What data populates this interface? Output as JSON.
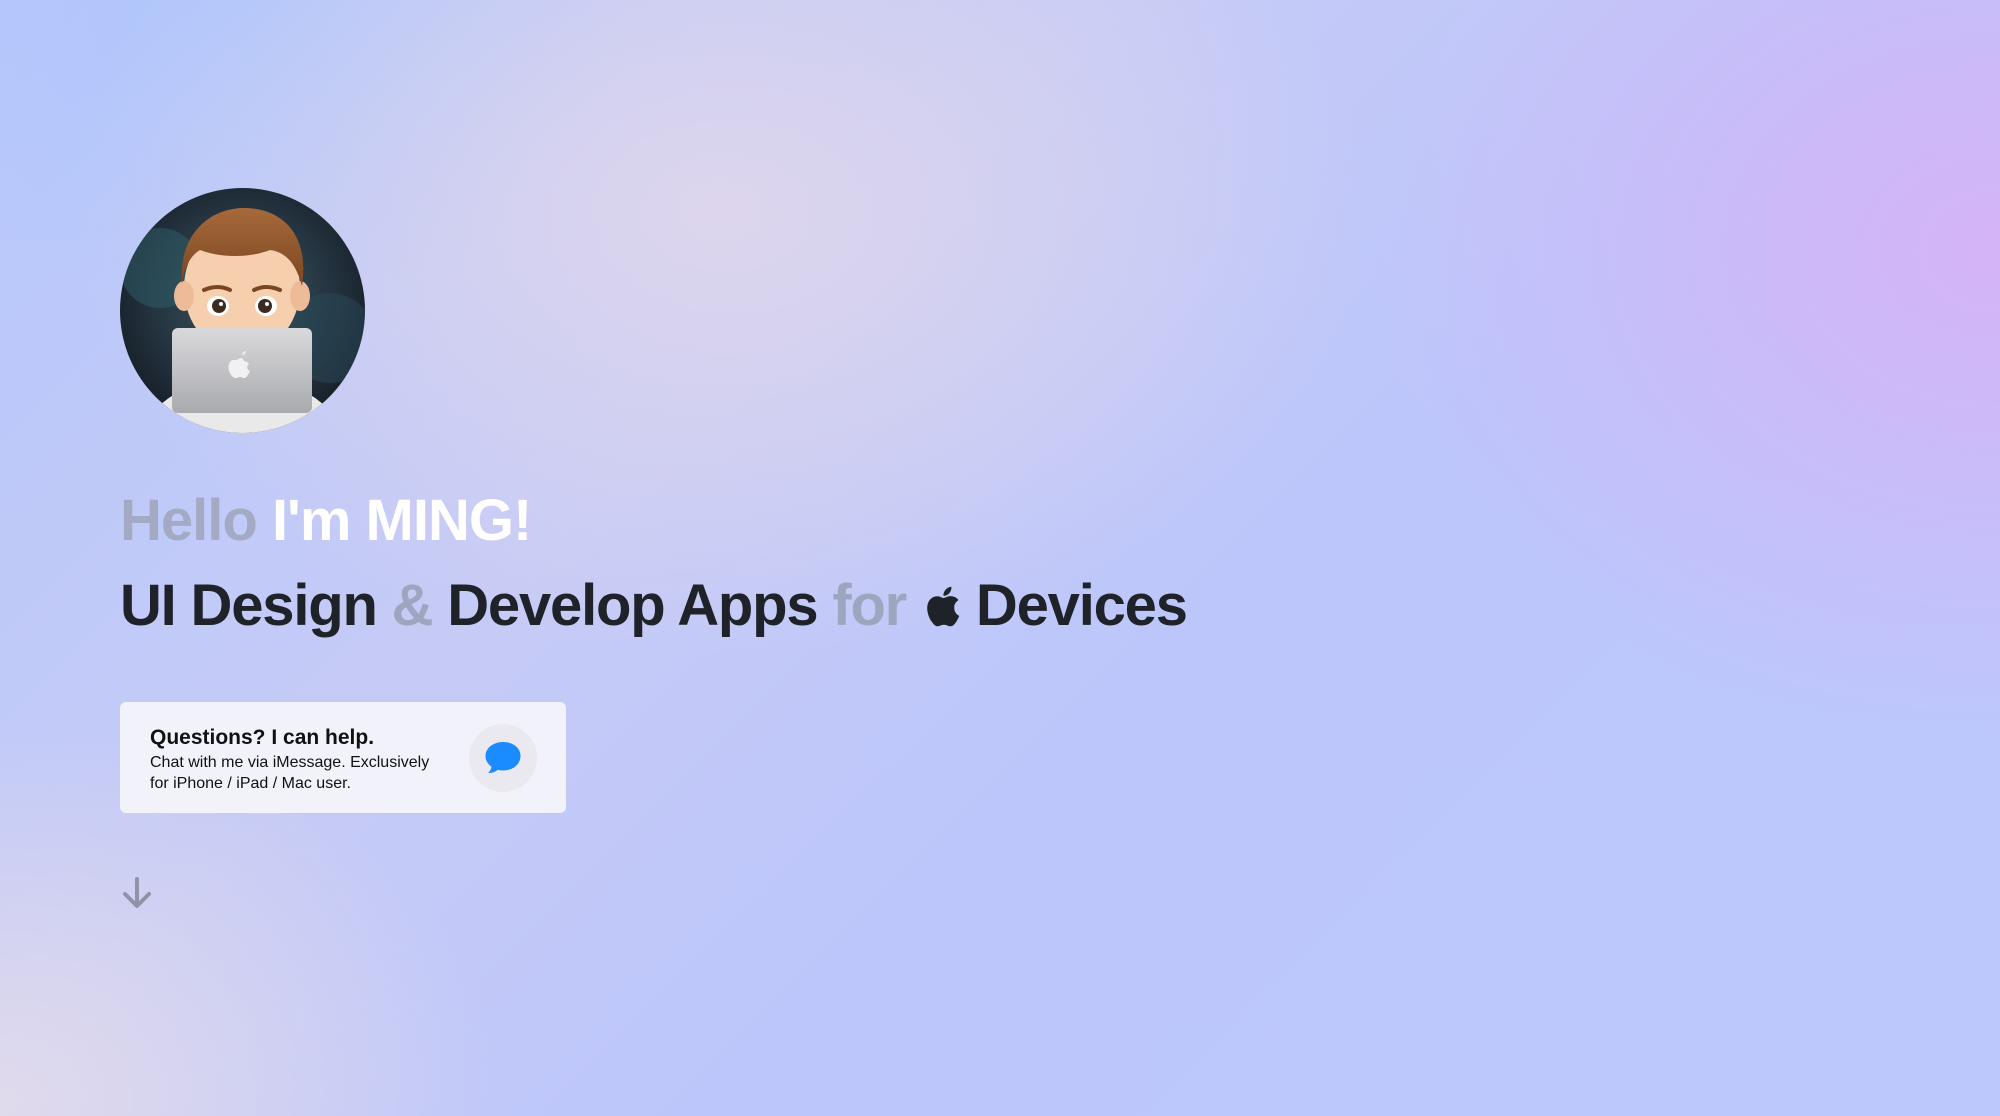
{
  "hero": {
    "greeting": {
      "hello": "Hello",
      "im": "I'm",
      "name": "MING!"
    },
    "tagline": {
      "ui_design": "UI Design",
      "ampersand": "&",
      "develop_apps": "Develop Apps",
      "for": "for",
      "devices": "Devices"
    }
  },
  "contact_card": {
    "title": "Questions? I can help.",
    "body": "Chat with me via iMessage. Exclusively for iPhone / iPad / Mac user.",
    "icon": "imessage-bubble-icon"
  },
  "icons": {
    "apple": "apple-logo-icon",
    "scroll": "arrow-down-icon"
  },
  "colors": {
    "heading_dark": "#1f2228",
    "muted_text": "#a4aac3",
    "white_text": "#ffffff",
    "imessage_blue": "#1a8cff"
  }
}
